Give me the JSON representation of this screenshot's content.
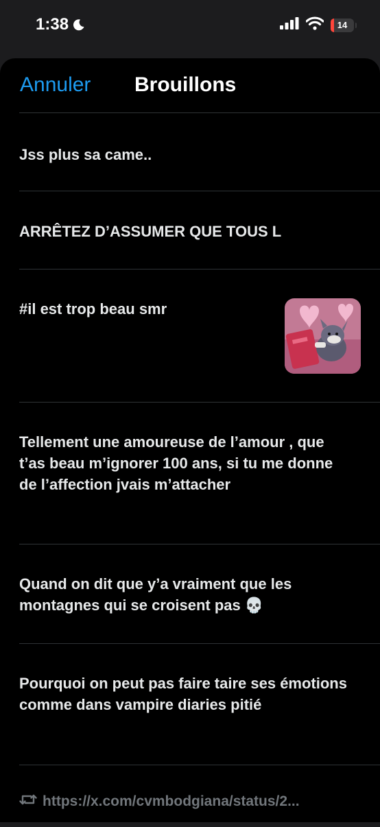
{
  "status_bar": {
    "time": "1:38",
    "battery_level": "14",
    "battery_fraction": 0.14,
    "battery_color": "#ff453a"
  },
  "header": {
    "cancel_label": "Annuler",
    "title": "Brouillons"
  },
  "drafts": [
    {
      "text": "Jss plus sa came.."
    },
    {
      "text": "ARRÊTEZ D’ASSUMER QUE TOUS L"
    },
    {
      "text": "#il est trop beau smr",
      "has_image": true
    },
    {
      "text": "Tellement une amoureuse de l’amour , que t’as beau m’ignorer 100 ans, si tu me donne de l’affection jvais m’attacher"
    },
    {
      "text": "Quand on dit que y’a vraiment que les montagnes qui se croisent pas 💀"
    },
    {
      "text": "Pourquoi on peut pas faire taire ses émotions comme dans vampire diaries pitié"
    },
    {
      "text": "https://x.com/cvmbodgiana/status/2...",
      "is_repost": true
    }
  ],
  "colors": {
    "accent": "#1d9bf0",
    "background": "#000000",
    "divider": "#2f3336",
    "muted": "#71767b"
  }
}
